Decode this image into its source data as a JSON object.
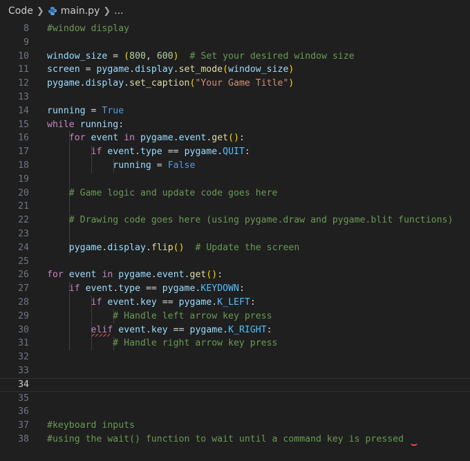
{
  "breadcrumb": {
    "folder": "Code",
    "file": "main.py",
    "symbol": "..."
  },
  "editor": {
    "current_line": "34",
    "lines": [
      {
        "num": "8",
        "tokens": [
          [
            "c",
            "#window display"
          ]
        ]
      },
      {
        "num": "9",
        "tokens": []
      },
      {
        "num": "10",
        "tokens": [
          [
            "v",
            "window_size"
          ],
          [
            "o",
            " = "
          ],
          [
            "p1",
            "("
          ],
          [
            "n",
            "800"
          ],
          [
            "o",
            ", "
          ],
          [
            "n",
            "600"
          ],
          [
            "p1",
            ")"
          ],
          [
            "o",
            "  "
          ],
          [
            "c",
            "# Set your desired window size"
          ]
        ]
      },
      {
        "num": "11",
        "tokens": [
          [
            "v",
            "screen"
          ],
          [
            "o",
            " = "
          ],
          [
            "v",
            "pygame"
          ],
          [
            "o",
            "."
          ],
          [
            "v",
            "display"
          ],
          [
            "o",
            "."
          ],
          [
            "f",
            "set_mode"
          ],
          [
            "p1",
            "("
          ],
          [
            "v",
            "window_size"
          ],
          [
            "p1",
            ")"
          ]
        ]
      },
      {
        "num": "12",
        "tokens": [
          [
            "v",
            "pygame"
          ],
          [
            "o",
            "."
          ],
          [
            "v",
            "display"
          ],
          [
            "o",
            "."
          ],
          [
            "f",
            "set_caption"
          ],
          [
            "p1",
            "("
          ],
          [
            "s",
            "\"Your Game Title\""
          ],
          [
            "p1",
            ")"
          ]
        ]
      },
      {
        "num": "13",
        "tokens": []
      },
      {
        "num": "14",
        "tokens": [
          [
            "v",
            "running"
          ],
          [
            "o",
            " = "
          ],
          [
            "b",
            "True"
          ]
        ]
      },
      {
        "num": "15",
        "tokens": [
          [
            "k",
            "while"
          ],
          [
            "o",
            " "
          ],
          [
            "v",
            "running"
          ],
          [
            "o",
            ":"
          ]
        ]
      },
      {
        "num": "16",
        "tokens": [
          [
            "o",
            "    "
          ],
          [
            "k",
            "for"
          ],
          [
            "o",
            " "
          ],
          [
            "v",
            "event"
          ],
          [
            "o",
            " "
          ],
          [
            "k",
            "in"
          ],
          [
            "o",
            " "
          ],
          [
            "v",
            "pygame"
          ],
          [
            "o",
            "."
          ],
          [
            "v",
            "event"
          ],
          [
            "o",
            "."
          ],
          [
            "f",
            "get"
          ],
          [
            "p1",
            "()"
          ],
          [
            "o",
            ":"
          ]
        ]
      },
      {
        "num": "17",
        "tokens": [
          [
            "o",
            "        "
          ],
          [
            "k",
            "if"
          ],
          [
            "o",
            " "
          ],
          [
            "v",
            "event"
          ],
          [
            "o",
            "."
          ],
          [
            "v",
            "type"
          ],
          [
            "o",
            " == "
          ],
          [
            "v",
            "pygame"
          ],
          [
            "o",
            "."
          ],
          [
            "m",
            "QUIT"
          ],
          [
            "o",
            ":"
          ]
        ]
      },
      {
        "num": "18",
        "tokens": [
          [
            "o",
            "            "
          ],
          [
            "v",
            "running"
          ],
          [
            "o",
            " = "
          ],
          [
            "b",
            "False"
          ]
        ]
      },
      {
        "num": "19",
        "tokens": []
      },
      {
        "num": "20",
        "tokens": [
          [
            "o",
            "    "
          ],
          [
            "c",
            "# Game logic and update code goes here"
          ]
        ]
      },
      {
        "num": "21",
        "tokens": []
      },
      {
        "num": "22",
        "tokens": [
          [
            "o",
            "    "
          ],
          [
            "c",
            "# Drawing code goes here (using pygame.draw and pygame.blit functions)"
          ]
        ]
      },
      {
        "num": "23",
        "tokens": []
      },
      {
        "num": "24",
        "tokens": [
          [
            "o",
            "    "
          ],
          [
            "v",
            "pygame"
          ],
          [
            "o",
            "."
          ],
          [
            "v",
            "display"
          ],
          [
            "o",
            "."
          ],
          [
            "f",
            "flip"
          ],
          [
            "p1",
            "()"
          ],
          [
            "o",
            "  "
          ],
          [
            "c",
            "# Update the screen"
          ]
        ]
      },
      {
        "num": "25",
        "tokens": []
      },
      {
        "num": "26",
        "tokens": [
          [
            "k",
            "for"
          ],
          [
            "o",
            " "
          ],
          [
            "v",
            "event"
          ],
          [
            "o",
            " "
          ],
          [
            "k",
            "in"
          ],
          [
            "o",
            " "
          ],
          [
            "v",
            "pygame"
          ],
          [
            "o",
            "."
          ],
          [
            "v",
            "event"
          ],
          [
            "o",
            "."
          ],
          [
            "f",
            "get"
          ],
          [
            "p1",
            "()"
          ],
          [
            "o",
            ":"
          ]
        ]
      },
      {
        "num": "27",
        "tokens": [
          [
            "o",
            "    "
          ],
          [
            "k",
            "if"
          ],
          [
            "o",
            " "
          ],
          [
            "v",
            "event"
          ],
          [
            "o",
            "."
          ],
          [
            "v",
            "type"
          ],
          [
            "o",
            " == "
          ],
          [
            "v",
            "pygame"
          ],
          [
            "o",
            "."
          ],
          [
            "m",
            "KEYDOWN"
          ],
          [
            "o",
            ":"
          ]
        ]
      },
      {
        "num": "28",
        "tokens": [
          [
            "o",
            "        "
          ],
          [
            "k",
            "if"
          ],
          [
            "o",
            " "
          ],
          [
            "v",
            "event"
          ],
          [
            "o",
            "."
          ],
          [
            "v",
            "key"
          ],
          [
            "o",
            " == "
          ],
          [
            "v",
            "pygame"
          ],
          [
            "o",
            "."
          ],
          [
            "m",
            "K_LEFT"
          ],
          [
            "o",
            ":"
          ]
        ]
      },
      {
        "num": "29",
        "tokens": [
          [
            "o",
            "            "
          ],
          [
            "c",
            "# Handle left arrow key press"
          ]
        ]
      },
      {
        "num": "30",
        "tokens": [
          [
            "o",
            "        "
          ],
          [
            "k",
            "elif"
          ],
          [
            "o",
            " "
          ],
          [
            "v",
            "event"
          ],
          [
            "o",
            "."
          ],
          [
            "v",
            "key"
          ],
          [
            "o",
            " == "
          ],
          [
            "v",
            "pygame"
          ],
          [
            "o",
            "."
          ],
          [
            "m",
            "K_RIGHT"
          ],
          [
            "o",
            ":"
          ]
        ]
      },
      {
        "num": "31",
        "tokens": [
          [
            "o",
            "            "
          ],
          [
            "c",
            "# Handle right arrow key press"
          ]
        ]
      },
      {
        "num": "32",
        "tokens": []
      },
      {
        "num": "33",
        "tokens": []
      },
      {
        "num": "34",
        "tokens": []
      },
      {
        "num": "35",
        "tokens": []
      },
      {
        "num": "36",
        "tokens": []
      },
      {
        "num": "37",
        "tokens": [
          [
            "c",
            "#keyboard inputs"
          ]
        ]
      },
      {
        "num": "38",
        "tokens": [
          [
            "c",
            "#using the wait() function to wait until a command key is pressed"
          ]
        ]
      }
    ]
  }
}
